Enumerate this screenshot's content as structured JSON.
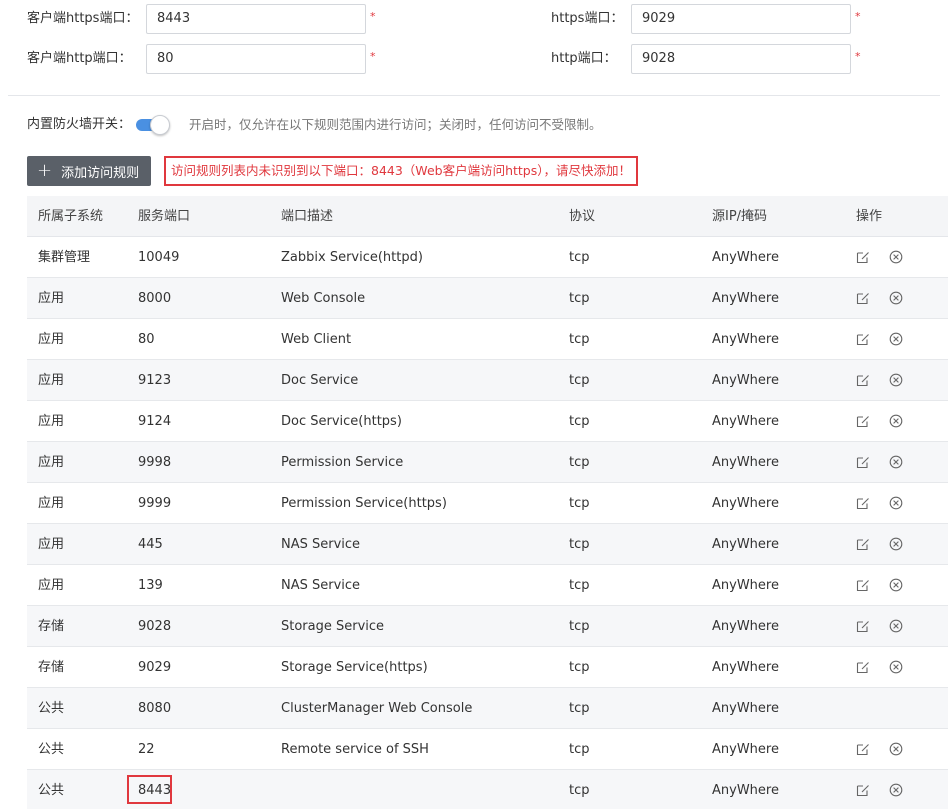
{
  "form": {
    "client_https_port": {
      "label": "客户端https端口：",
      "value": "8443",
      "required_mark": "*"
    },
    "client_http_port": {
      "label": "客户端http端口：",
      "value": "80",
      "required_mark": "*"
    },
    "https_port": {
      "label": "https端口：",
      "value": "9029",
      "required_mark": "*"
    },
    "http_port": {
      "label": "http端口：",
      "value": "9028",
      "required_mark": "*"
    }
  },
  "firewall": {
    "label": "内置防火墙开关：",
    "enabled": true,
    "hint": "开启时，仅允许在以下规则范围内进行访问；关闭时，任何访问不受限制。"
  },
  "toolbar": {
    "add_rule_label": "添加访问规则",
    "warning": "访问规则列表内未识别到以下端口：8443（Web客户端访问https），请尽快添加！"
  },
  "table": {
    "headers": [
      "所属子系统",
      "服务端口",
      "端口描述",
      "协议",
      "源IP/掩码",
      "操作"
    ],
    "rows": [
      {
        "subsystem": "集群管理",
        "port": "10049",
        "desc": "Zabbix Service(httpd)",
        "protocol": "tcp",
        "source": "AnyWhere",
        "actions": true
      },
      {
        "subsystem": "应用",
        "port": "8000",
        "desc": "Web Console",
        "protocol": "tcp",
        "source": "AnyWhere",
        "actions": true
      },
      {
        "subsystem": "应用",
        "port": "80",
        "desc": "Web Client",
        "protocol": "tcp",
        "source": "AnyWhere",
        "actions": true
      },
      {
        "subsystem": "应用",
        "port": "9123",
        "desc": "Doc Service",
        "protocol": "tcp",
        "source": "AnyWhere",
        "actions": true
      },
      {
        "subsystem": "应用",
        "port": "9124",
        "desc": "Doc Service(https)",
        "protocol": "tcp",
        "source": "AnyWhere",
        "actions": true
      },
      {
        "subsystem": "应用",
        "port": "9998",
        "desc": "Permission Service",
        "protocol": "tcp",
        "source": "AnyWhere",
        "actions": true
      },
      {
        "subsystem": "应用",
        "port": "9999",
        "desc": "Permission Service(https)",
        "protocol": "tcp",
        "source": "AnyWhere",
        "actions": true
      },
      {
        "subsystem": "应用",
        "port": "445",
        "desc": "NAS Service",
        "protocol": "tcp",
        "source": "AnyWhere",
        "actions": true
      },
      {
        "subsystem": "应用",
        "port": "139",
        "desc": "NAS Service",
        "protocol": "tcp",
        "source": "AnyWhere",
        "actions": true
      },
      {
        "subsystem": "存储",
        "port": "9028",
        "desc": "Storage Service",
        "protocol": "tcp",
        "source": "AnyWhere",
        "actions": true
      },
      {
        "subsystem": "存储",
        "port": "9029",
        "desc": "Storage Service(https)",
        "protocol": "tcp",
        "source": "AnyWhere",
        "actions": true
      },
      {
        "subsystem": "公共",
        "port": "8080",
        "desc": "ClusterManager Web Console",
        "protocol": "tcp",
        "source": "AnyWhere",
        "actions": false
      },
      {
        "subsystem": "公共",
        "port": "22",
        "desc": "Remote service of SSH",
        "protocol": "tcp",
        "source": "AnyWhere",
        "actions": true
      },
      {
        "subsystem": "公共",
        "port": "8443",
        "desc": "",
        "protocol": "tcp",
        "source": "AnyWhere",
        "actions": true,
        "highlighted": true
      }
    ]
  },
  "icons": {
    "edit": "edit-icon",
    "delete": "delete-circle-x-icon"
  },
  "colors": {
    "accent": "#4a90e2",
    "warning": "#e0383e",
    "button_bg": "#5a6068"
  }
}
